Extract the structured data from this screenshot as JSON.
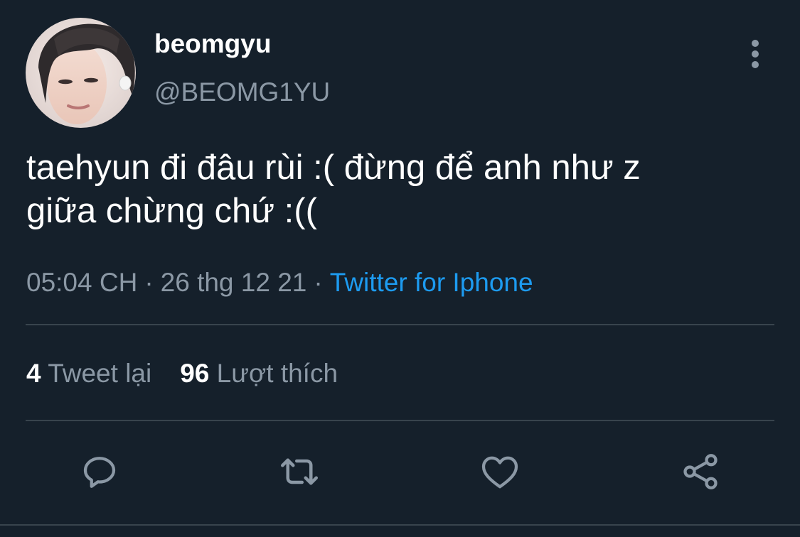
{
  "user": {
    "display_name": "beomgyu",
    "handle": "@BEOMG1YU",
    "avatar_icon": "profile-photo"
  },
  "tweet": {
    "lines": [
      "taehyun đi đâu rùi :( đừng để anh như z",
      "giữa chừng chứ :(("
    ],
    "time": "05:04 CH",
    "date": "26 thg 12 21",
    "separator": "·",
    "source": "Twitter for Iphone"
  },
  "stats": {
    "retweets_count": "4",
    "retweets_label": "Tweet lại",
    "likes_count": "96",
    "likes_label": "Lượt thích"
  },
  "actions": [
    "reply-icon",
    "retweet-icon",
    "like-icon",
    "share-icon"
  ],
  "colors": {
    "background": "#15202b",
    "text": "#ffffff",
    "muted": "#8b98a5",
    "link": "#1d9bf0",
    "divider": "#38444d"
  }
}
